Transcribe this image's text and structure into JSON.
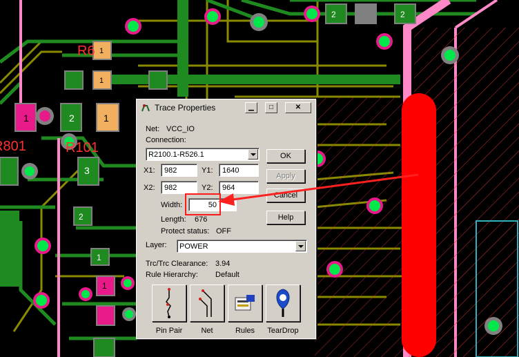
{
  "dialog": {
    "title": "Trace Properties",
    "window_buttons": {
      "minimize": "▁",
      "maximize": "□",
      "close": "✕"
    },
    "net_label": "Net:",
    "net_value": "VCC_IO",
    "connection_label": "Connection:",
    "connection_value": "R2100.1-R526.1",
    "x1_label": "X1:",
    "x1_value": "982",
    "y1_label": "Y1:",
    "y1_value": "1640",
    "x2_label": "X2:",
    "x2_value": "982",
    "y2_label": "Y2:",
    "y2_value": "964",
    "width_label": "Width:",
    "width_value": "50",
    "length_label": "Length:",
    "length_value": "676",
    "protect_label": "Protect status:",
    "protect_value": "OFF",
    "layer_label": "Layer:",
    "layer_value": "POWER",
    "clearance_label": "Trc/Trc Clearance:",
    "clearance_value": "3.94",
    "hierarchy_label": "Rule Hierarchy:",
    "hierarchy_value": "Default",
    "buttons": {
      "ok": "OK",
      "apply": "Apply",
      "cancel": "Cancel",
      "help": "Help"
    },
    "tiles": [
      {
        "label": "Pin Pair",
        "icon": "pin-pair-icon"
      },
      {
        "label": "Net",
        "icon": "net-icon"
      },
      {
        "label": "Rules",
        "icon": "rules-icon"
      },
      {
        "label": "TearDrop",
        "icon": "teardrop-icon"
      }
    ]
  },
  "pcb": {
    "labels": {
      "r6": "R6",
      "d1a": "1",
      "d1b": "1",
      "r101": "R101",
      "r801": "R801",
      "p2a": "2",
      "p2b": "2",
      "p3": "3",
      "p1": "1",
      "p1c": "1",
      "p2c": "2",
      "p2d": "2",
      "p1d": "1",
      "p1e": "1"
    },
    "colors": {
      "background": "#000000",
      "trace_green": "#1f8a1f",
      "trace_olive": "#8a8a00",
      "pour_red": "#ff0000",
      "pink": "#ff88c8",
      "via_green": "#00e84a",
      "pad_orange": "#f0b060",
      "pad_magenta": "#e81a8a"
    }
  },
  "annotation": {
    "arrow_color": "#ff2020"
  }
}
